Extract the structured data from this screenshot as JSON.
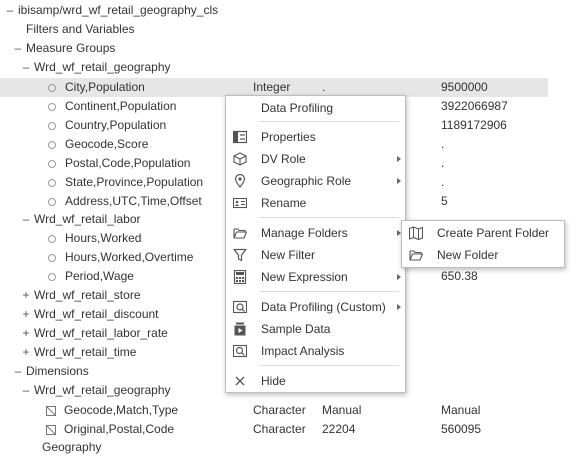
{
  "tree": {
    "root": {
      "toggle": "–",
      "label": "ibisamp/wrd_wf_retail_geography_cls"
    },
    "filters": {
      "label": "Filters and Variables"
    },
    "measure_groups": {
      "toggle": "–",
      "label": "Measure Groups"
    },
    "geo_group": {
      "toggle": "–",
      "label": "Wrd_wf_retail_geography"
    },
    "geo_measures": [
      {
        "label": "City,Population",
        "type": "Integer",
        "mid": ".",
        "value": "9500000"
      },
      {
        "label": "Continent,Population",
        "type": "",
        "mid": "",
        "value": "3922066987"
      },
      {
        "label": "Country,Population",
        "type": "",
        "mid": "",
        "value": "1189172906"
      },
      {
        "label": "Geocode,Score",
        "type": "",
        "mid": "",
        "value": "."
      },
      {
        "label": "Postal,Code,Population",
        "type": "",
        "mid": "",
        "value": "."
      },
      {
        "label": "State,Province,Population",
        "type": "",
        "mid": "",
        "value": "."
      },
      {
        "label": "Address,UTC,Time,Offset",
        "type": "",
        "mid": "",
        "value": "5"
      }
    ],
    "labor_group": {
      "toggle": "–",
      "label": "Wrd_wf_retail_labor"
    },
    "labor_measures": [
      {
        "label": "Hours,Worked",
        "value": ""
      },
      {
        "label": "Hours,Worked,Overtime",
        "value": ""
      },
      {
        "label": "Period,Wage",
        "value": "650.38"
      }
    ],
    "collapsed_groups": [
      {
        "toggle": "+",
        "label": "Wrd_wf_retail_store"
      },
      {
        "toggle": "+",
        "label": "Wrd_wf_retail_discount"
      },
      {
        "toggle": "+",
        "label": "Wrd_wf_retail_labor_rate"
      },
      {
        "toggle": "+",
        "label": "Wrd_wf_retail_time"
      }
    ],
    "dimensions": {
      "toggle": "–",
      "label": "Dimensions"
    },
    "dim_geo_group": {
      "toggle": "–",
      "label": "Wrd_wf_retail_geography"
    },
    "dim_fields": [
      {
        "label": "Geocode,Match,Type",
        "type": "Character",
        "mid": "Manual",
        "value": "Manual"
      },
      {
        "label": "Original,Postal,Code",
        "type": "Character",
        "mid": "22204",
        "value": "560095"
      }
    ],
    "partial_label": "Geography"
  },
  "context_menu": {
    "items": [
      {
        "label": "Data Profiling",
        "icon": "none",
        "submenu": false
      },
      {
        "label": "Properties",
        "icon": "properties-icon",
        "submenu": false
      },
      {
        "label": "DV Role",
        "icon": "cube-icon",
        "submenu": true
      },
      {
        "label": "Geographic Role",
        "icon": "map-pin-icon",
        "submenu": true
      },
      {
        "label": "Rename",
        "icon": "rename-icon",
        "submenu": false
      },
      {
        "label": "Manage Folders",
        "icon": "folder-open-icon",
        "submenu": true
      },
      {
        "label": "New Filter",
        "icon": "filter-icon",
        "submenu": false
      },
      {
        "label": "New Expression",
        "icon": "calculator-icon",
        "submenu": true
      },
      {
        "label": "Data Profiling (Custom)",
        "icon": "profiling-custom-icon",
        "submenu": true
      },
      {
        "label": "Sample Data",
        "icon": "sample-data-icon",
        "submenu": false
      },
      {
        "label": "Impact Analysis",
        "icon": "impact-analysis-icon",
        "submenu": false
      },
      {
        "label": "Hide",
        "icon": "close-icon",
        "submenu": false
      }
    ]
  },
  "submenu": {
    "items": [
      {
        "label": "Create Parent Folder",
        "icon": "map-folder-icon"
      },
      {
        "label": "New Folder",
        "icon": "folder-open-icon"
      }
    ]
  },
  "colors": {
    "selected_row": "#e6e6e6",
    "menu_border": "#bdbdbd",
    "icon_gray": "#666666"
  }
}
